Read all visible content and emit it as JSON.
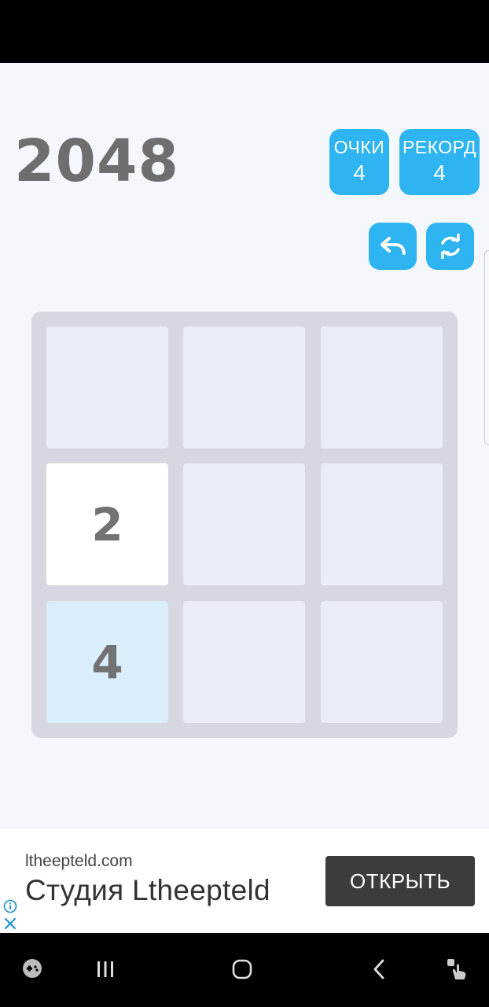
{
  "game": {
    "title": "2048",
    "score_label": "ОЧКИ",
    "score_value": "4",
    "record_label": "РЕКОРД",
    "record_value": "4"
  },
  "controls": {
    "undo_icon": "undo-icon",
    "restart_icon": "refresh-icon"
  },
  "board": {
    "size": 3,
    "cells": [
      "",
      "",
      "",
      "2",
      "",
      "",
      "4",
      "",
      ""
    ]
  },
  "ad": {
    "domain": "ltheepteld.com",
    "title": "Студия Ltheepteld",
    "button_label": "ОТКРЫТЬ",
    "info_icon": "info-icon",
    "close_icon": "close-icon"
  },
  "nav": {
    "icons": [
      "game-launcher-icon",
      "recent-apps-icon",
      "home-icon",
      "back-icon",
      "gesture-icon"
    ]
  },
  "colors": {
    "accent": "#2eb4f0",
    "title": "#6e6e6e",
    "board": "#d6d7e0",
    "empty_cell": "#e9eef6",
    "tile_2": "#ffffff",
    "tile_4": "#daedfa",
    "ad_button": "#3c3c3c"
  }
}
